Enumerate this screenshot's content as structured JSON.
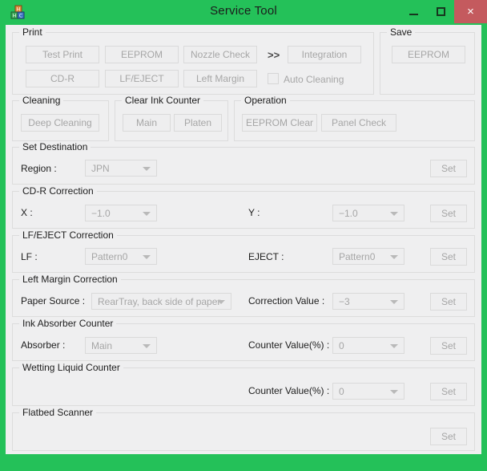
{
  "window": {
    "title": "Service Tool",
    "icon": "app-blocks-icon",
    "accent_color": "#24c159",
    "close_color": "#c45a5e",
    "client_color": "#efeff0",
    "controls": {
      "minimize": "minimize-icon",
      "maximize": "maximize-icon",
      "close": "×"
    }
  },
  "print": {
    "title": "Print",
    "buttons": [
      {
        "label": "Test Print"
      },
      {
        "label": "EEPROM"
      },
      {
        "label": "Nozzle Check"
      },
      {
        "label": "Integration"
      },
      {
        "label": "CD-R"
      },
      {
        "label": "LF/EJECT"
      },
      {
        "label": "Left Margin"
      }
    ],
    "separator": ">>",
    "checkbox": {
      "label": "Auto Cleaning",
      "checked": false
    }
  },
  "save": {
    "title": "Save",
    "button": "EEPROM"
  },
  "cleaning": {
    "title": "Cleaning",
    "button": "Deep Cleaning"
  },
  "clear_ink_counter": {
    "title": "Clear Ink Counter",
    "buttons": [
      "Main",
      "Platen"
    ]
  },
  "operation": {
    "title": "Operation",
    "buttons": [
      "EEPROM Clear",
      "Panel Check"
    ]
  },
  "set_destination": {
    "title": "Set Destination",
    "region_label": "Region :",
    "region_value": "JPN",
    "set_label": "Set"
  },
  "cdr_correction": {
    "title": "CD-R Correction",
    "x_label": "X :",
    "x_value": "−1.0",
    "y_label": "Y :",
    "y_value": "−1.0",
    "set_label": "Set"
  },
  "lf_eject_correction": {
    "title": "LF/EJECT Correction",
    "lf_label": "LF :",
    "lf_value": "Pattern0",
    "eject_label": "EJECT :",
    "eject_value": "Pattern0",
    "set_label": "Set"
  },
  "left_margin_correction": {
    "title": "Left Margin Correction",
    "paper_source_label": "Paper Source :",
    "paper_source_value": "RearTray, back side of paper",
    "correction_value_label": "Correction Value :",
    "correction_value": "−3",
    "set_label": "Set"
  },
  "ink_absorber_counter": {
    "title": "Ink Absorber Counter",
    "absorber_label": "Absorber :",
    "absorber_value": "Main",
    "counter_label": "Counter Value(%) :",
    "counter_value": "0",
    "set_label": "Set"
  },
  "wetting_liquid_counter": {
    "title": "Wetting Liquid Counter",
    "counter_label": "Counter Value(%) :",
    "counter_value": "0",
    "set_label": "Set"
  },
  "flatbed_scanner": {
    "title": "Flatbed Scanner",
    "set_label": "Set"
  }
}
